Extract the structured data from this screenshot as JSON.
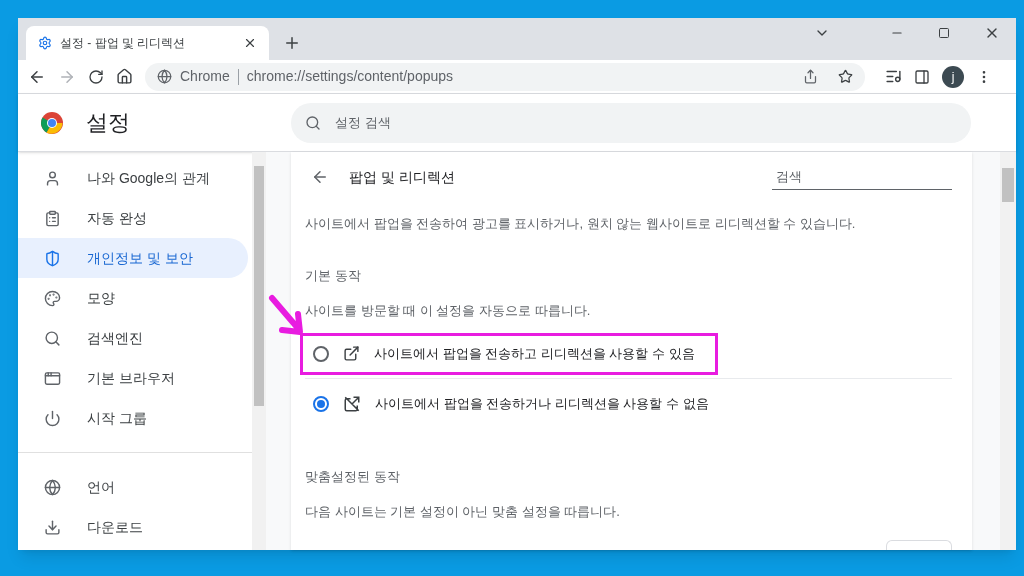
{
  "tab": {
    "title": "설정 - 팝업 및 리디렉션"
  },
  "address_bar": {
    "origin": "Chrome",
    "url": "chrome://settings/content/popups"
  },
  "profile": {
    "initial": "j"
  },
  "header": {
    "title": "설정",
    "search": {
      "placeholder": "설정 검색"
    }
  },
  "sidebar": {
    "groups": [
      [
        {
          "label": "나와 Google의 관계",
          "kind": "person",
          "selected": false
        },
        {
          "label": "자동 완성",
          "kind": "clipboard",
          "selected": false
        },
        {
          "label": "개인정보 및 보안",
          "kind": "shield",
          "selected": true
        },
        {
          "label": "모양",
          "kind": "palette",
          "selected": false
        },
        {
          "label": "검색엔진",
          "kind": "search",
          "selected": false
        },
        {
          "label": "기본 브라우저",
          "kind": "browser",
          "selected": false
        },
        {
          "label": "시작 그룹",
          "kind": "power",
          "selected": false
        }
      ],
      [
        {
          "label": "언어",
          "kind": "globe",
          "selected": false
        },
        {
          "label": "다운로드",
          "kind": "download",
          "selected": false
        }
      ]
    ]
  },
  "page": {
    "title": "팝업 및 리디렉션",
    "search": {
      "placeholder": "검색"
    },
    "description": "사이트에서 팝업을 전송하여 광고를 표시하거나, 원치 않는 웹사이트로 리디렉션할 수 있습니다.",
    "default_section": {
      "heading": "기본 동작",
      "subtitle": "사이트를 방문할 때 이 설정을 자동으로 따릅니다.",
      "options": [
        {
          "label": "사이트에서 팝업을 전송하고 리디렉션을 사용할 수 있음",
          "kind": "allow",
          "selected": false,
          "highlighted": true
        },
        {
          "label": "사이트에서 팝업을 전송하거나 리디렉션을 사용할 수 없음",
          "kind": "block",
          "selected": true,
          "highlighted": false
        }
      ]
    },
    "custom_section": {
      "heading": "맞춤설정된 동작",
      "subtitle": "다음 사이트는 기본 설정이 아닌 맞춤 설정을 따릅니다."
    }
  }
}
